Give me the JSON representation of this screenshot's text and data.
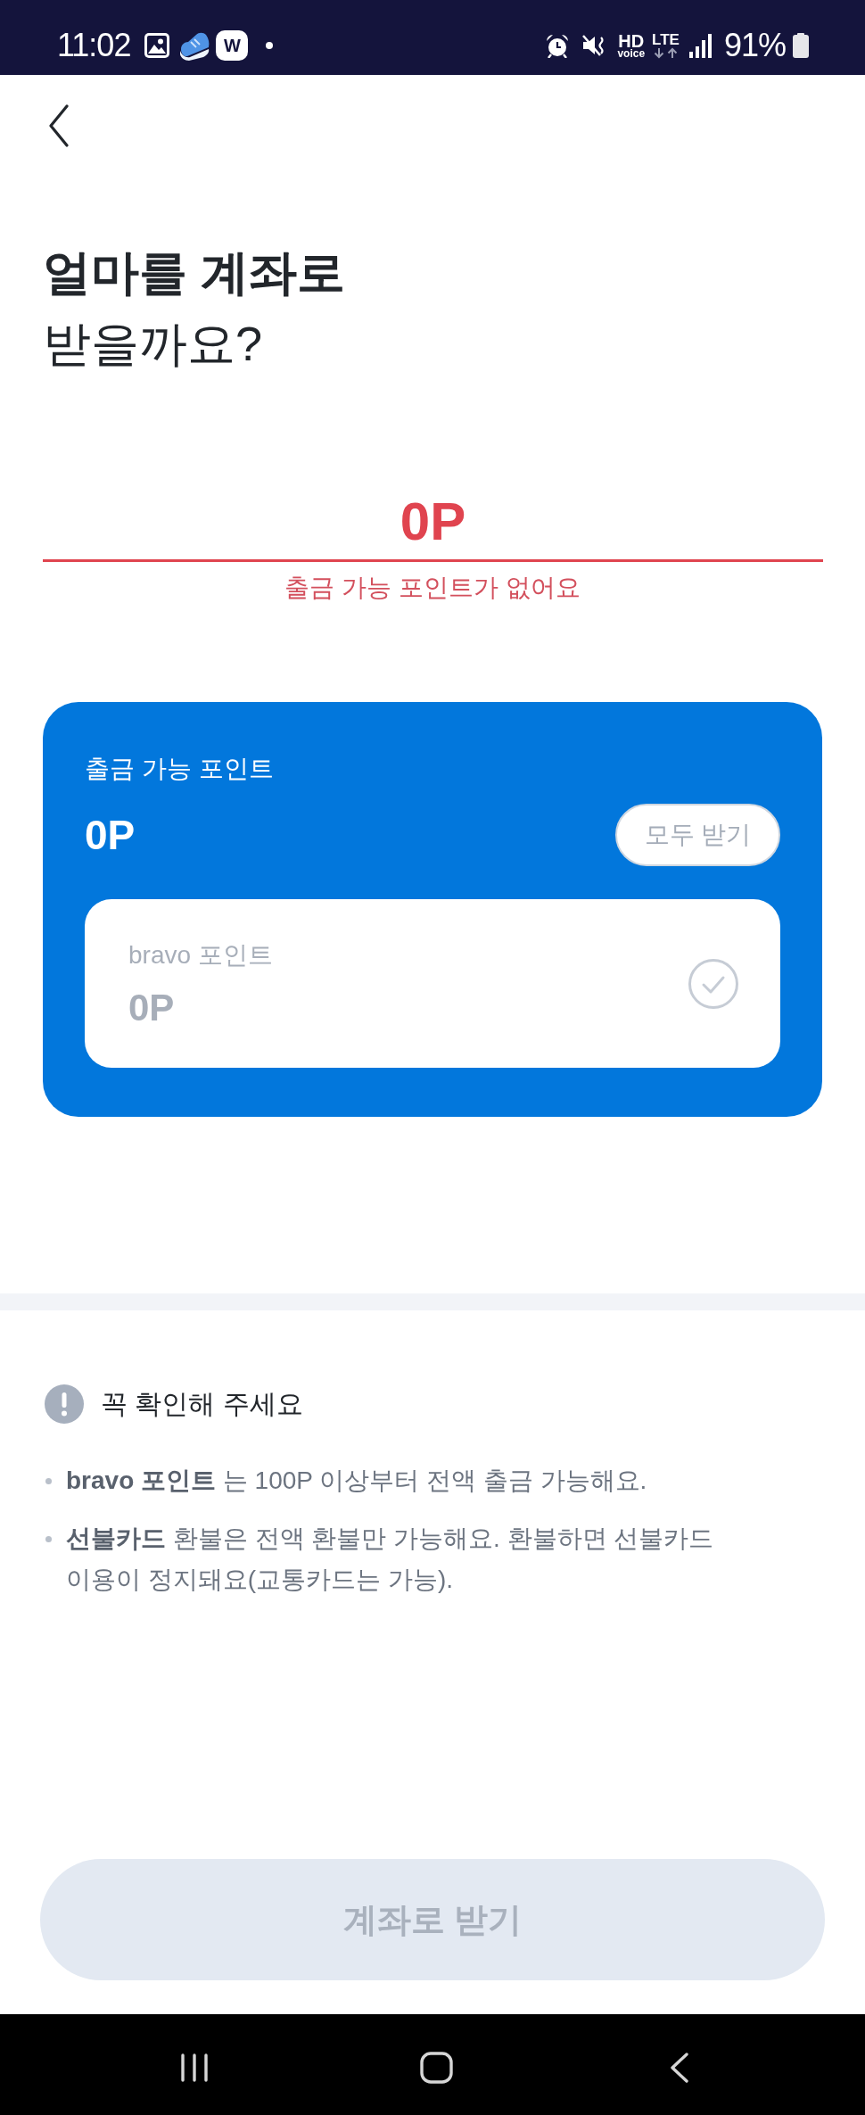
{
  "status_bar": {
    "time": "11:02",
    "app_badge": "W",
    "hd_label": "HD",
    "voice_label": "voice",
    "network_label": "LTE",
    "battery": "91%"
  },
  "title": "**얼마를 계좌로** 받을까요?",
  "amount_field": {
    "value": "0P",
    "error": true,
    "error_message": "출금 가능 포인트가 없어요"
  },
  "points_card": {
    "label": "출금 가능 포인트",
    "total": "0P",
    "claim_all_button": {
      "label": "모두 받기",
      "disabled": true
    },
    "sources": [
      {
        "name": "bravo 포인트",
        "amount": "0P",
        "selected": false,
        "disabled": true
      }
    ]
  },
  "notice": {
    "title": "꼭 확인해 주세요",
    "items": [
      "**bravo 포인트** 는 100P 이상부터 전액 출금 가능해요.",
      "**선불카드** 환불은 전액 환불만 가능해요. 환불하면 선불카드 이용이 정지돼요(교통카드는 가능)."
    ]
  },
  "submit_button": {
    "label": "계좌로 받기",
    "disabled": true
  }
}
